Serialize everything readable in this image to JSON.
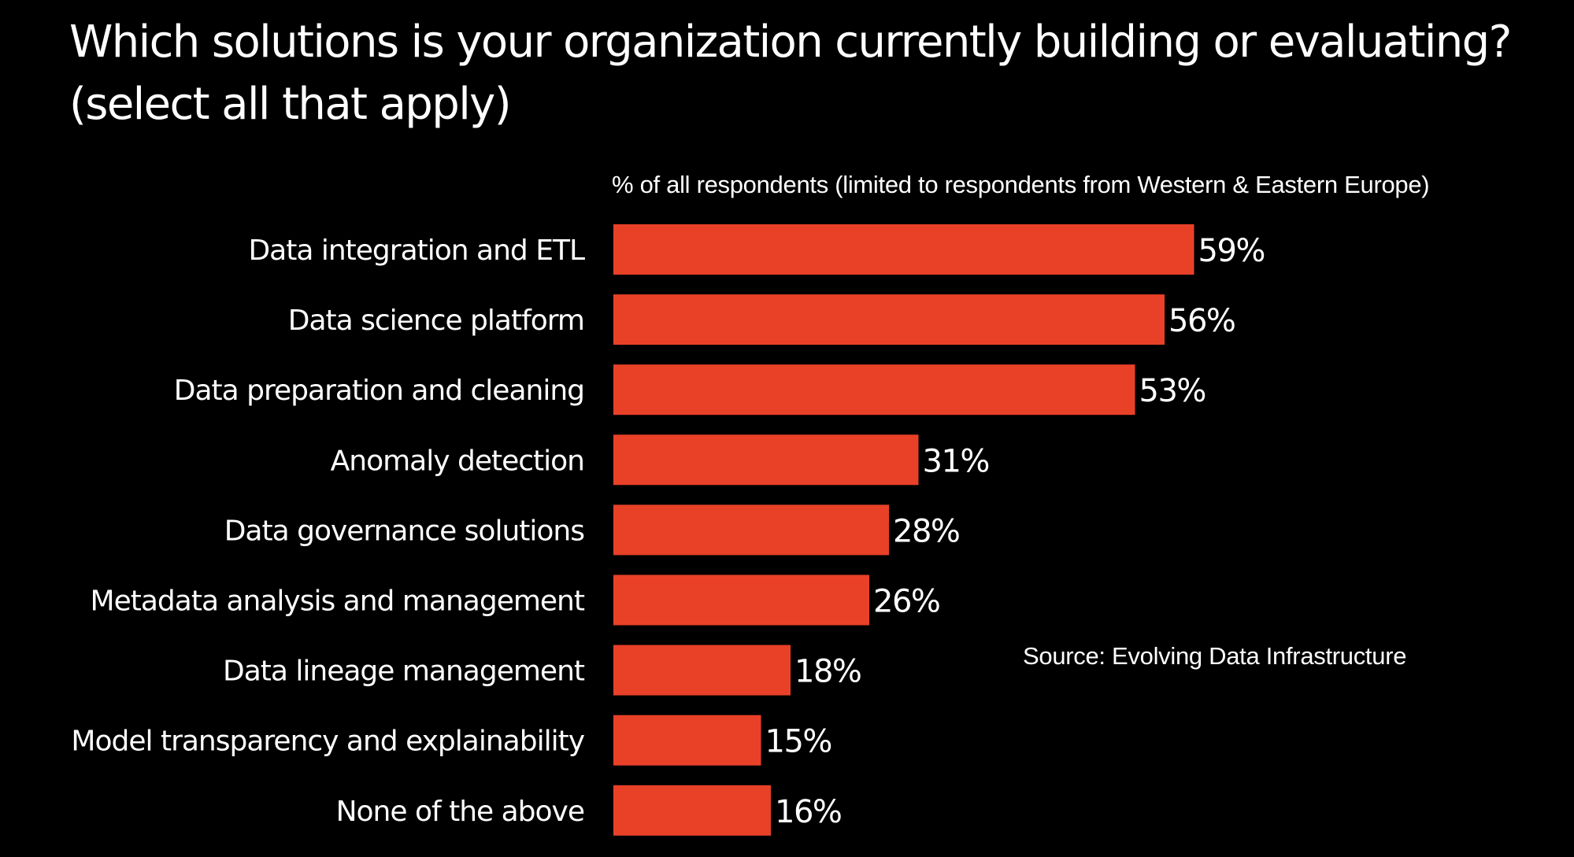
{
  "chart_data": {
    "type": "bar",
    "orientation": "horizontal",
    "title": "Which solutions is your organization currently building or evaluating?",
    "title_line2": "(select all that apply)",
    "subtitle": "% of all respondents (limited to respondents from Western & Eastern Europe)",
    "source": "Source: Evolving Data Infrastructure",
    "xlabel": "% of all respondents (limited to respondents from Western & Eastern Europe)",
    "ylabel": "",
    "unit": "%",
    "xlim": [
      0,
      100
    ],
    "grid": false,
    "legend": "none",
    "bar_color": "#E94128",
    "categories": [
      "Data integration and ETL",
      "Data science platform",
      "Data preparation and cleaning",
      "Anomaly detection",
      "Data governance solutions",
      "Metadata analysis and management",
      "Data lineage management",
      "Model transparency and explainability",
      "None of the above"
    ],
    "values": [
      59,
      56,
      53,
      31,
      28,
      26,
      18,
      15,
      16
    ],
    "value_labels": [
      "59%",
      "56%",
      "53%",
      "31%",
      "28%",
      "26%",
      "18%",
      "15%",
      "16%"
    ]
  }
}
